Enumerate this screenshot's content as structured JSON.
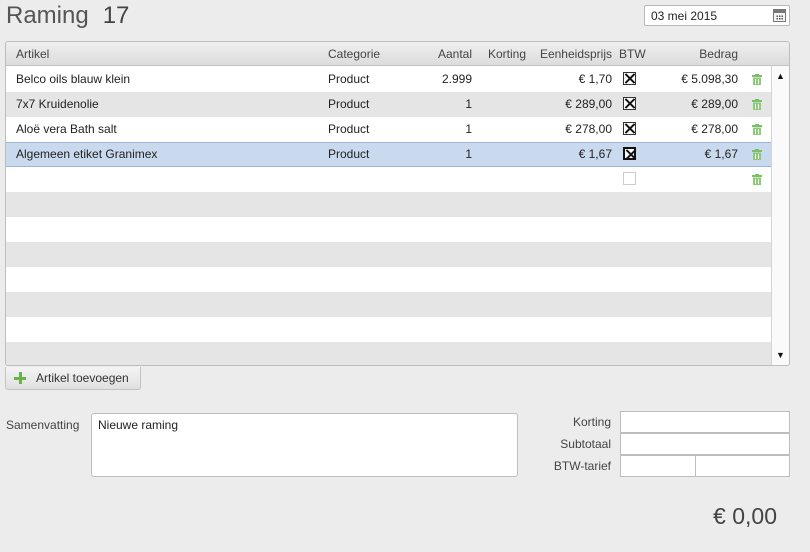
{
  "header": {
    "title": "Raming",
    "number": "17",
    "date": "03 mei 2015"
  },
  "grid": {
    "columns": {
      "artikel": "Artikel",
      "categorie": "Categorie",
      "aantal": "Aantal",
      "korting": "Korting",
      "eenheidsprijs": "Eenheidsprijs",
      "btw": "BTW",
      "bedrag": "Bedrag"
    },
    "rows": [
      {
        "artikel": "Belco oils blauw klein",
        "categorie": "Product",
        "aantal": "2.999",
        "korting": "",
        "eenheidsprijs": "€ 1,70",
        "btw": true,
        "bedrag": "€ 5.098,30"
      },
      {
        "artikel": "7x7 Kruidenolie",
        "categorie": "Product",
        "aantal": "1",
        "korting": "",
        "eenheidsprijs": "€ 289,00",
        "btw": true,
        "bedrag": "€ 289,00"
      },
      {
        "artikel": "Aloë vera Bath salt",
        "categorie": "Product",
        "aantal": "1",
        "korting": "",
        "eenheidsprijs": "€ 278,00",
        "btw": true,
        "bedrag": "€ 278,00"
      },
      {
        "artikel": "Algemeen etiket Granimex",
        "categorie": "Product",
        "aantal": "1",
        "korting": "",
        "eenheidsprijs": "€ 1,67",
        "btw": true,
        "bedrag": "€ 1,67"
      }
    ],
    "selected_row": 3,
    "scroll_up": "▲",
    "scroll_down": "▼"
  },
  "actions": {
    "add_article": "Artikel toevoegen"
  },
  "summary": {
    "label": "Samenvatting",
    "value": "Nieuwe raming"
  },
  "totals": {
    "korting_label": "Korting",
    "subtotaal_label": "Subtotaal",
    "btw_tarief_label": "BTW-tarief",
    "total": "€ 0,00"
  },
  "colors": {
    "selection": "#c9d9ee",
    "accent_green": "#6ab04c",
    "row_alt": "#e5e5e5"
  }
}
